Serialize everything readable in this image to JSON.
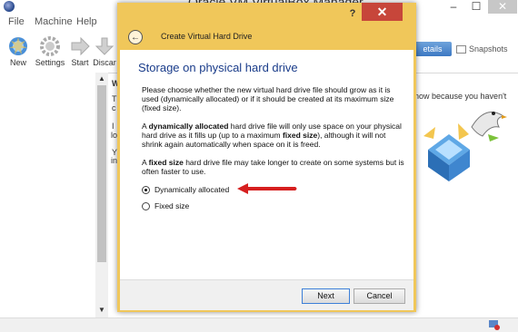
{
  "manager": {
    "title": "Oracle VM VirtualBox Manager",
    "window_controls": {
      "minimize": "–",
      "maximize": "☐",
      "close": "✕"
    },
    "menu": [
      "File",
      "Machine",
      "Help"
    ],
    "toolbar": [
      {
        "label": "New",
        "icon": "new-icon"
      },
      {
        "label": "Settings",
        "icon": "settings-gear-icon"
      },
      {
        "label": "Start",
        "icon": "start-arrow-icon"
      },
      {
        "label": "Discar",
        "icon": "discard-arrow-icon"
      }
    ],
    "tabs": {
      "details": "etails",
      "snapshots": "Snapshots"
    },
    "behind_dialog_peek": [
      "W",
      "T",
      "c",
      "I",
      "lo",
      "Y",
      "in"
    ],
    "right_text": "now because you haven't"
  },
  "dialog": {
    "help": "?",
    "close": "✕",
    "header_title": "Create Virtual Hard Drive",
    "page_title": "Storage on physical hard drive",
    "para1": "Please choose whether the new virtual hard drive file should grow as it is used (dynamically allocated) or if it should be created at its maximum size (fixed size).",
    "para2_a": "A ",
    "para2_b": "dynamically allocated",
    "para2_c": " hard drive file will only use space on your physical hard drive as it fills up (up to a maximum ",
    "para2_d": "fixed size",
    "para2_e": "), although it will not shrink again automatically when space on it is freed.",
    "para3_a": "A ",
    "para3_b": "fixed size",
    "para3_c": " hard drive file may take longer to create on some systems but is often faster to use.",
    "options": [
      {
        "label": "Dynamically allocated",
        "checked": true
      },
      {
        "label": "Fixed size",
        "checked": false
      }
    ],
    "buttons": {
      "next": "Next",
      "cancel": "Cancel"
    }
  },
  "colors": {
    "title_bar": "#f0c75a",
    "close": "#c7463a",
    "heading": "#1a3c8a",
    "arrow": "#d61f1f"
  }
}
